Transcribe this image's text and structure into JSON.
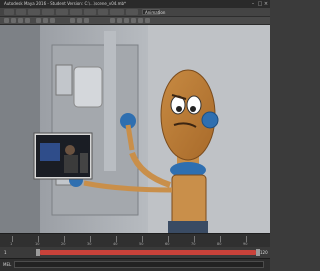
{
  "window": {
    "title": "Autodesk Maya 2016 - Student Version: C:\\...\\scene_v04.mb*",
    "mode_dropdown": "Animation"
  },
  "viewport": {
    "description_icon": "3d-viewport",
    "inset_video": "reference-video"
  },
  "timeline": {
    "ticks": [
      "1",
      "10",
      "20",
      "30",
      "40",
      "50",
      "60",
      "70",
      "80",
      "90"
    ]
  },
  "range": {
    "start": "1",
    "end": "120"
  },
  "command_line": {
    "label": "MEL"
  },
  "colors": {
    "accent": "#c8423a",
    "viewport_bg": "#8f9398",
    "ui_dark": "#3b3b3b"
  }
}
